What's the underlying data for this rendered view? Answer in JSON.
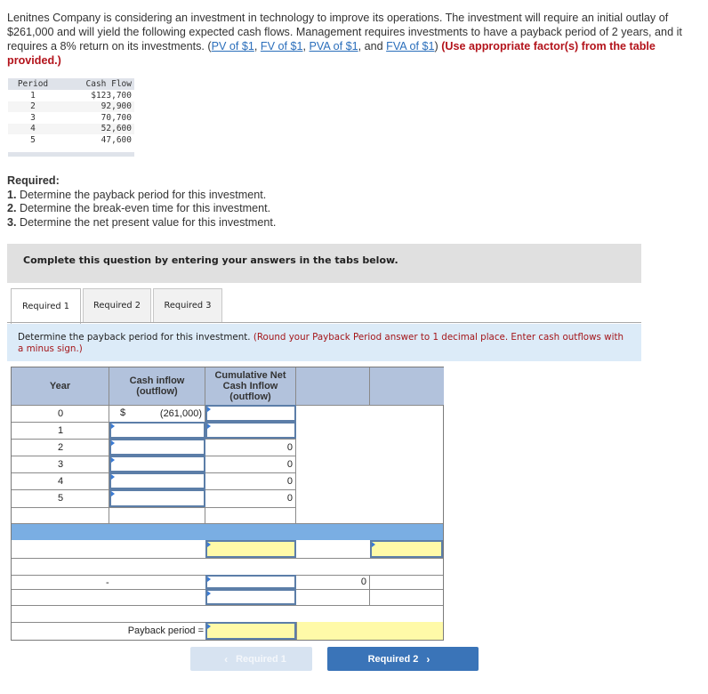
{
  "problem": {
    "text_1": "Lenitnes Company is considering an investment in technology to improve its operations. The investment will require an initial outlay of $261,000 and will yield the following expected cash flows. Management requires investments to have a payback period of 2 years, and it requires a 8% return on its investments. (",
    "links": [
      "PV of $1",
      "FV of $1",
      "PVA of $1",
      "FVA of $1"
    ],
    "sep_1": ", ",
    "sep_2": ", ",
    "sep_3": ", and ",
    "close_paren": ") ",
    "instruction": "(Use appropriate factor(s) from the table provided.)"
  },
  "cash_flow_table": {
    "headers": [
      "Period",
      "Cash Flow"
    ],
    "rows": [
      {
        "period": "1",
        "cash_flow": "$123,700"
      },
      {
        "period": "2",
        "cash_flow": "92,900"
      },
      {
        "period": "3",
        "cash_flow": "70,700"
      },
      {
        "period": "4",
        "cash_flow": "52,600"
      },
      {
        "period": "5",
        "cash_flow": "47,600"
      }
    ]
  },
  "required": {
    "heading": "Required:",
    "items": [
      {
        "num": "1.",
        "text": " Determine the payback period for this investment."
      },
      {
        "num": "2.",
        "text": " Determine the break-even time for this investment."
      },
      {
        "num": "3.",
        "text": " Determine the net present value for this investment."
      }
    ]
  },
  "instruction_box": "Complete this question by entering your answers in the tabs below.",
  "tabs": [
    {
      "label": "Required 1",
      "active": true
    },
    {
      "label": "Required 2",
      "active": false
    },
    {
      "label": "Required 3",
      "active": false
    }
  ],
  "prompt": {
    "text": "Determine the payback period for this investment. ",
    "note": "(Round your Payback Period answer to 1 decimal place. Enter cash outflows with a minus sign.)"
  },
  "worksheet": {
    "headers": {
      "year": "Year",
      "cash_inflow": "Cash inflow (outflow)",
      "cumulative": "Cumulative Net Cash Inflow (outflow)"
    },
    "rows": [
      {
        "year": "0",
        "cash_symbol": "$",
        "cash_value": "(261,000)",
        "cumulative": ""
      },
      {
        "year": "1",
        "cash_value": "",
        "cumulative": ""
      },
      {
        "year": "2",
        "cash_value": "",
        "cumulative": "0"
      },
      {
        "year": "3",
        "cash_value": "",
        "cumulative": "0"
      },
      {
        "year": "4",
        "cash_value": "",
        "cumulative": "0"
      },
      {
        "year": "5",
        "cash_value": "",
        "cumulative": "0"
      }
    ],
    "calc_minus_sign": "-",
    "calc_zero": "0",
    "payback_label": "Payback period ="
  },
  "nav": {
    "prev_label": "Required 1",
    "next_label": "Required 2",
    "prev_icon": "‹",
    "next_icon": "›"
  },
  "colors": {
    "link": "#2a6ebb",
    "warning_red": "#b3131b",
    "header_blue": "#b2c2dc",
    "band_blue": "#7aaee3",
    "answer_yellow": "#fffaa8",
    "primary_button": "#3a74b8"
  }
}
